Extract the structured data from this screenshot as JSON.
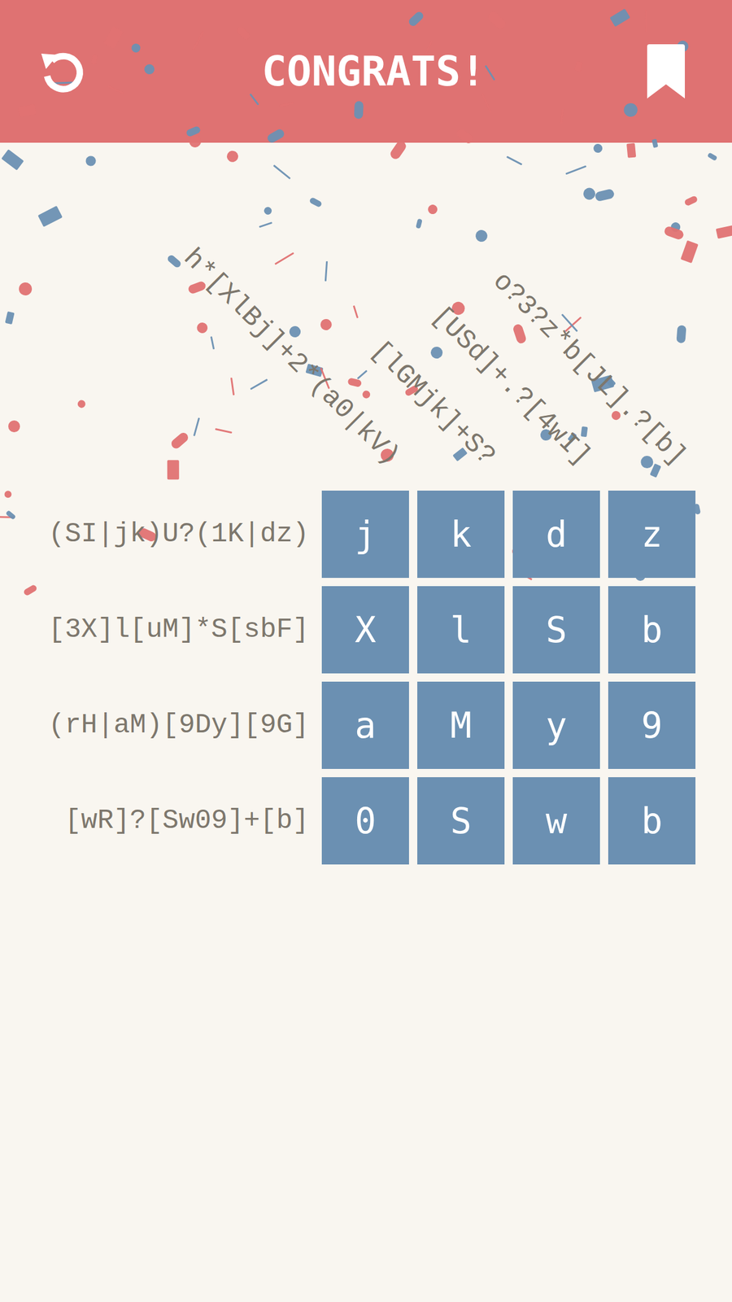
{
  "header": {
    "title": "CONGRATS!"
  },
  "solved": true,
  "column_clues": [
    "h*[XlBj]+2*(a0|kV)",
    "[lGMjk]+S?",
    "[USd]+.?[4wI]",
    "o?3?z*b[JL].?[b]"
  ],
  "rows": [
    {
      "clue": "(SI|jk)U?(1K|dz)",
      "cells": [
        "j",
        "k",
        "d",
        "z"
      ]
    },
    {
      "clue": "[3X]l[uM]*S[sbF]",
      "cells": [
        "X",
        "l",
        "S",
        "b"
      ]
    },
    {
      "clue": "(rH|aM)[9Dy][9G]",
      "cells": [
        "a",
        "M",
        "y",
        "9"
      ]
    },
    {
      "clue": "[wR]?[Sw09]+[b]",
      "cells": [
        "0",
        "S",
        "w",
        "b"
      ]
    }
  ]
}
